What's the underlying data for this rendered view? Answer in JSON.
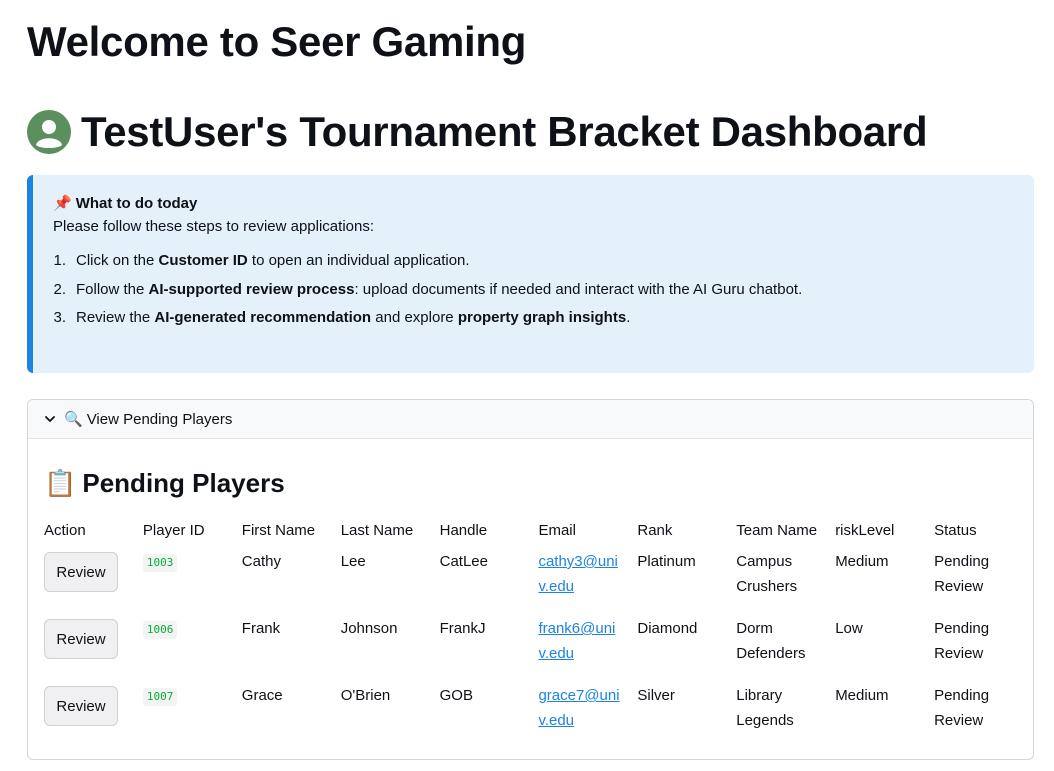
{
  "page": {
    "title": "Welcome to Seer Gaming",
    "dashboard_title": "TestUser's Tournament Bracket Dashboard"
  },
  "icons": {
    "avatar": "user-avatar-icon",
    "pin": "pushpin-icon",
    "search": "magnifying-glass-icon",
    "clipboard": "clipboard-icon",
    "chevron": "chevron-down-icon"
  },
  "colors": {
    "accent": "#1c83e1",
    "info_bg": "#e4f1fa",
    "avatar_green": "#5b8f5e",
    "id_green": "#09ab3b"
  },
  "info": {
    "heading_emoji": "📌",
    "heading": "What to do today",
    "intro": "Please follow these steps to review applications:",
    "steps": [
      {
        "num": "1.",
        "pre": "Click on the ",
        "b1": "Customer ID",
        "mid": " to open an individual application.",
        "b2": "",
        "post": ""
      },
      {
        "num": "2.",
        "pre": "Follow the ",
        "b1": "AI-supported review process",
        "mid": ": upload documents if needed and interact with the AI Guru chatbot.",
        "b2": "",
        "post": ""
      },
      {
        "num": "3.",
        "pre": "Review the ",
        "b1": "AI-generated recommendation",
        "mid": " and explore ",
        "b2": "property graph insights",
        "post": "."
      }
    ]
  },
  "expander": {
    "emoji": "🔍",
    "label": "View Pending Players"
  },
  "pending": {
    "emoji": "📋",
    "title": "Pending Players",
    "columns": [
      "Action",
      "Player ID",
      "First Name",
      "Last Name",
      "Handle",
      "Email",
      "Rank",
      "Team Name",
      "riskLevel",
      "Status"
    ],
    "rows": [
      {
        "action": "Review",
        "id": "1003",
        "first": "Cathy",
        "last": "Lee",
        "handle": "CatLee",
        "email_l1": "cathy3@uni",
        "email_l2": "v.edu",
        "rank": "Platinum",
        "team_l1": "Campus",
        "team_l2": "Crushers",
        "risk": "Medium",
        "status_l1": "Pending",
        "status_l2": "Review"
      },
      {
        "action": "Review",
        "id": "1006",
        "first": "Frank",
        "last": "Johnson",
        "handle": "FrankJ",
        "email_l1": "frank6@uni",
        "email_l2": "v.edu",
        "rank": "Diamond",
        "team_l1": "Dorm",
        "team_l2": "Defenders",
        "risk": "Low",
        "status_l1": "Pending",
        "status_l2": "Review"
      },
      {
        "action": "Review",
        "id": "1007",
        "first": "Grace",
        "last": "O'Brien",
        "handle": "GOB",
        "email_l1": "grace7@uni",
        "email_l2": "v.edu",
        "rank": "Silver",
        "team_l1": "Library",
        "team_l2": "Legends",
        "risk": "Medium",
        "status_l1": "Pending",
        "status_l2": "Review"
      }
    ]
  }
}
